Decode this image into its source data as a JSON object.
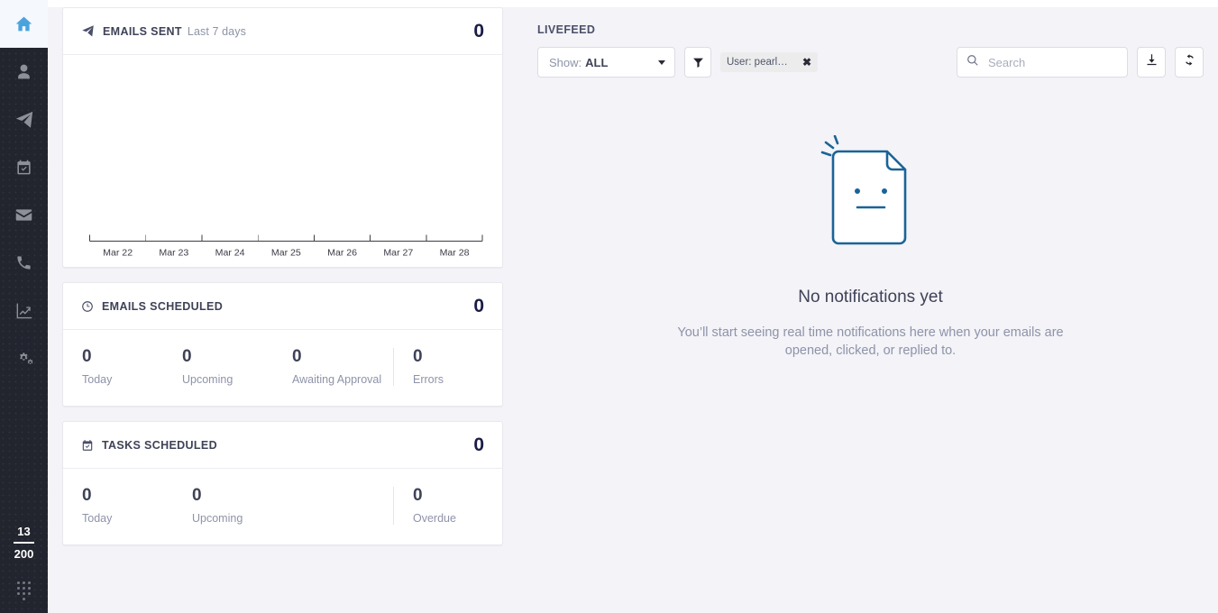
{
  "sidebar": {
    "items": [
      {
        "name": "home",
        "icon": "home-icon",
        "active": true
      },
      {
        "name": "contacts",
        "icon": "user-icon",
        "active": false
      },
      {
        "name": "campaigns",
        "icon": "paper-plane-icon",
        "active": false
      },
      {
        "name": "tasks",
        "icon": "calendar-check-icon",
        "active": false
      },
      {
        "name": "mail",
        "icon": "envelope-icon",
        "active": false
      },
      {
        "name": "calls",
        "icon": "phone-icon",
        "active": false
      },
      {
        "name": "reports",
        "icon": "line-chart-icon",
        "active": false
      },
      {
        "name": "settings",
        "icon": "cogs-icon",
        "active": false
      }
    ],
    "credits": {
      "used": "13",
      "total": "200"
    },
    "keypad_icon": "dial-pad-icon"
  },
  "emails_sent": {
    "icon": "paper-plane-icon",
    "title": "EMAILS SENT",
    "subtitle": "Last 7 days",
    "total": "0"
  },
  "chart_data": {
    "type": "bar",
    "title": "EMAILS SENT",
    "subtitle": "Last 7 days",
    "categories": [
      "Mar 22",
      "Mar 23",
      "Mar 24",
      "Mar 25",
      "Mar 26",
      "Mar 27",
      "Mar 28"
    ],
    "values": [
      0,
      0,
      0,
      0,
      0,
      0,
      0
    ],
    "xlabel": "",
    "ylabel": "",
    "ylim": [
      0,
      0
    ],
    "grid": false,
    "legend": false
  },
  "emails_scheduled": {
    "icon": "clock-icon",
    "title": "EMAILS SCHEDULED",
    "total": "0",
    "stats": [
      {
        "value": "0",
        "label": "Today",
        "divided": false
      },
      {
        "value": "0",
        "label": "Upcoming",
        "divided": false
      },
      {
        "value": "0",
        "label": "Awaiting Approval",
        "divided": false
      },
      {
        "value": "0",
        "label": "Errors",
        "divided": true
      }
    ]
  },
  "tasks_scheduled": {
    "icon": "calendar-check-icon",
    "title": "TASKS SCHEDULED",
    "total": "0",
    "stats": [
      {
        "value": "0",
        "label": "Today",
        "divided": false
      },
      {
        "value": "0",
        "label": "Upcoming",
        "divided": false
      },
      {
        "value": "0",
        "label": "Overdue",
        "divided": true
      }
    ]
  },
  "livefeed": {
    "title": "LIVEFEED",
    "show_select": {
      "label": "Show:",
      "value": "ALL"
    },
    "filter_button_icon": "funnel-icon",
    "user_chip": {
      "text": "User: pearl@pear...",
      "remove_icon": "close-icon"
    },
    "search": {
      "placeholder": "Search",
      "value": "",
      "icon": "search-icon"
    },
    "export_button_icon": "download-icon",
    "refresh_button_icon": "refresh-icon",
    "empty_state": {
      "illustration": "document-neutral-face-icon",
      "title": "No notifications yet",
      "description": "You’ll start seeing real time notifications here when your emails are opened, clicked, or replied to."
    }
  },
  "colors": {
    "sidebar_bg": "#22242e",
    "active_icon": "#4ba3de",
    "page_bg": "#f3f3f8",
    "card_bg": "#ffffff",
    "heading": "#3f4257",
    "muted": "#8e93a8",
    "total": "#1b1b46",
    "illustration": "#1a6496"
  }
}
